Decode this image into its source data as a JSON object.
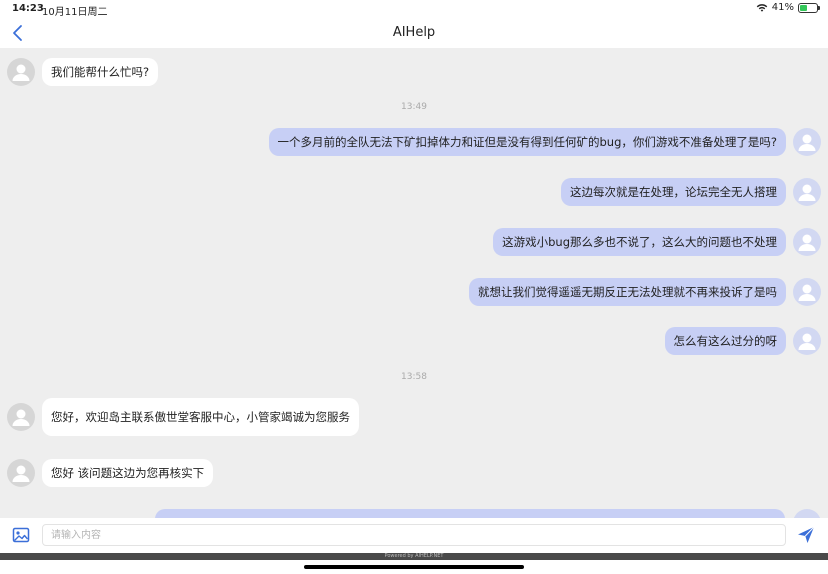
{
  "status_bar": {
    "time": "14:23",
    "date": "10月11日周二",
    "battery": "41%"
  },
  "nav": {
    "title": "AIHelp"
  },
  "messages": [
    {
      "sender": "agent",
      "text": "我们能帮什么忙吗?"
    },
    {
      "sender": "user",
      "text": "一个多月前的全队无法下矿扣掉体力和证但是没有得到任何矿的bug，你们游戏不准备处理了是吗?"
    },
    {
      "sender": "user",
      "text": "这边每次就是在处理，论坛完全无人搭理"
    },
    {
      "sender": "user",
      "text": "这游戏小bug那么多也不说了，这么大的问题也不处理"
    },
    {
      "sender": "user",
      "text": "就想让我们觉得遥遥无期反正无法处理就不再来投诉了是吗"
    },
    {
      "sender": "user",
      "text": "怎么有这么过分的呀"
    },
    {
      "sender": "agent",
      "text": "您好，欢迎岛主联系傲世堂客服中心，小管家竭诚为您服务"
    },
    {
      "sender": "agent",
      "text": "您好 该问题这边为您再核实下"
    }
  ],
  "timestamps": [
    "13:49",
    "13:58"
  ],
  "input": {
    "placeholder": "请输入内容"
  },
  "footer": {
    "powered": "Powered by AIHELP.NET"
  },
  "colors": {
    "user_bubble": "#c7cff5",
    "agent_bubble": "#ffffff",
    "chat_bg": "#eeeeee",
    "accent": "#3b6fd8"
  }
}
